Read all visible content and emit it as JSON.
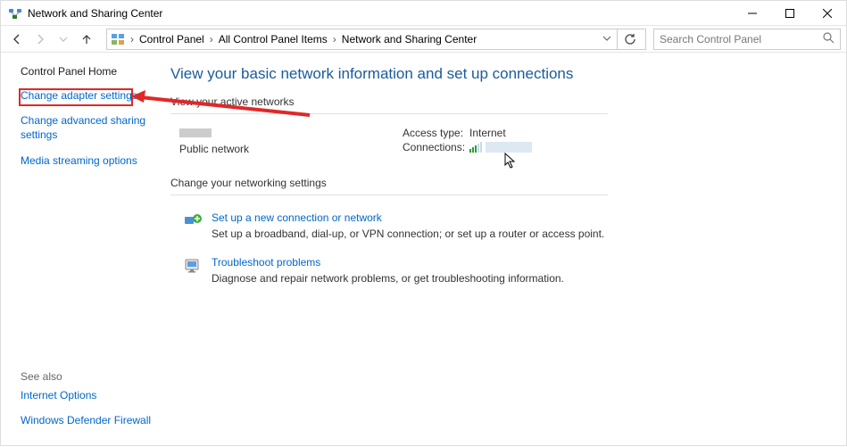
{
  "titlebar": {
    "title": "Network and Sharing Center"
  },
  "breadcrumb": {
    "items": [
      "Control Panel",
      "All Control Panel Items",
      "Network and Sharing Center"
    ]
  },
  "search": {
    "placeholder": "Search Control Panel"
  },
  "sidebar": {
    "home": "Control Panel Home",
    "links": [
      "Change adapter settings",
      "Change advanced sharing settings",
      "Media streaming options"
    ],
    "see_also_label": "See also",
    "see_also": [
      "Internet Options",
      "Windows Defender Firewall"
    ]
  },
  "content": {
    "heading": "View your basic network information and set up connections",
    "active_label": "View your active networks",
    "network": {
      "type_label": "Public network",
      "access_label": "Access type:",
      "access_value": "Internet",
      "connections_label": "Connections:"
    },
    "change_label": "Change your networking settings",
    "settings": [
      {
        "link": "Set up a new connection or network",
        "desc": "Set up a broadband, dial-up, or VPN connection; or set up a router or access point."
      },
      {
        "link": "Troubleshoot problems",
        "desc": "Diagnose and repair network problems, or get troubleshooting information."
      }
    ]
  }
}
